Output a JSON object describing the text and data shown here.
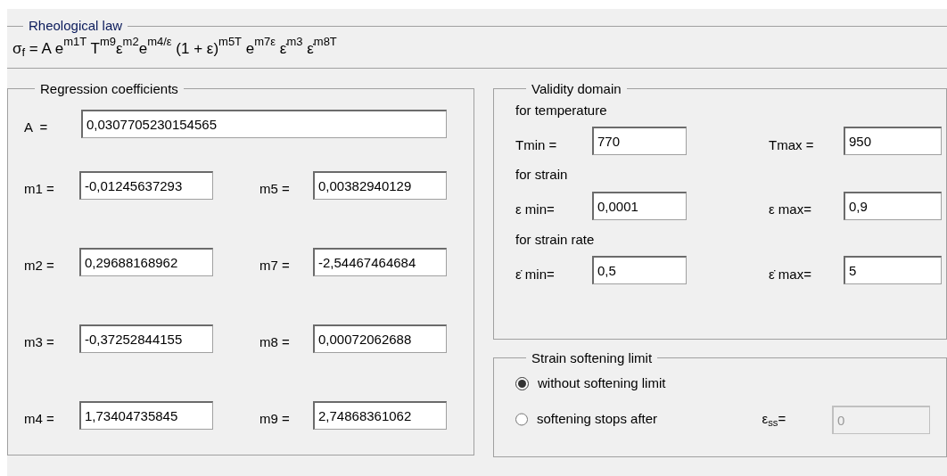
{
  "rheological_law": {
    "title": "Rheological law",
    "formula": "σ$_{f}$ = A e$^{m1T}$ T$^{m9}$ε$^{m2}$e$^{m4/ε}$ (1 + ε)$^{m5T}$ e$^{m7ε}$ ε̇$^{m3}$ ε̇$^{m8T}$"
  },
  "regression_coefficients": {
    "title": "Regression coefficients",
    "a": {
      "label": "A  =",
      "value": "0,0307705230154565"
    },
    "coefficients": [
      {
        "label": "m1 =",
        "value": "-0,01245637293"
      },
      {
        "label": "m5 =",
        "value": "0,00382940129"
      },
      {
        "label": "m2 =",
        "value": "0,29688168962"
      },
      {
        "label": "m7 =",
        "value": "-2,54467464684"
      },
      {
        "label": "m3 =",
        "value": "-0,37252844155"
      },
      {
        "label": "m8 =",
        "value": "0,00072062688"
      },
      {
        "label": "m4 =",
        "value": "1,73404735845"
      },
      {
        "label": "m9 =",
        "value": "2,74868361062"
      }
    ]
  },
  "validity_domain": {
    "title": "Validity domain",
    "sections": [
      {
        "heading": "for temperature",
        "min": {
          "label": "Tmin =",
          "value": "770"
        },
        "max": {
          "label": "Tmax =",
          "value": "950"
        }
      },
      {
        "heading": "for strain",
        "min": {
          "label": "ε min=",
          "value": "0,0001"
        },
        "max": {
          "label": "ε max=",
          "value": "0,9"
        }
      },
      {
        "heading": "for strain rate",
        "min": {
          "label": "ε̇ min=",
          "value": "0,5"
        },
        "max": {
          "label": "ε̇ max=",
          "value": "5"
        }
      }
    ]
  },
  "strain_softening_limit": {
    "title": "Strain softening limit",
    "options": [
      {
        "label": "without softening limit",
        "selected": true
      },
      {
        "label": "softening stops after",
        "selected": false
      }
    ],
    "ess": {
      "label": "ε$_{ss}$=",
      "value": "0",
      "disabled": true
    }
  }
}
